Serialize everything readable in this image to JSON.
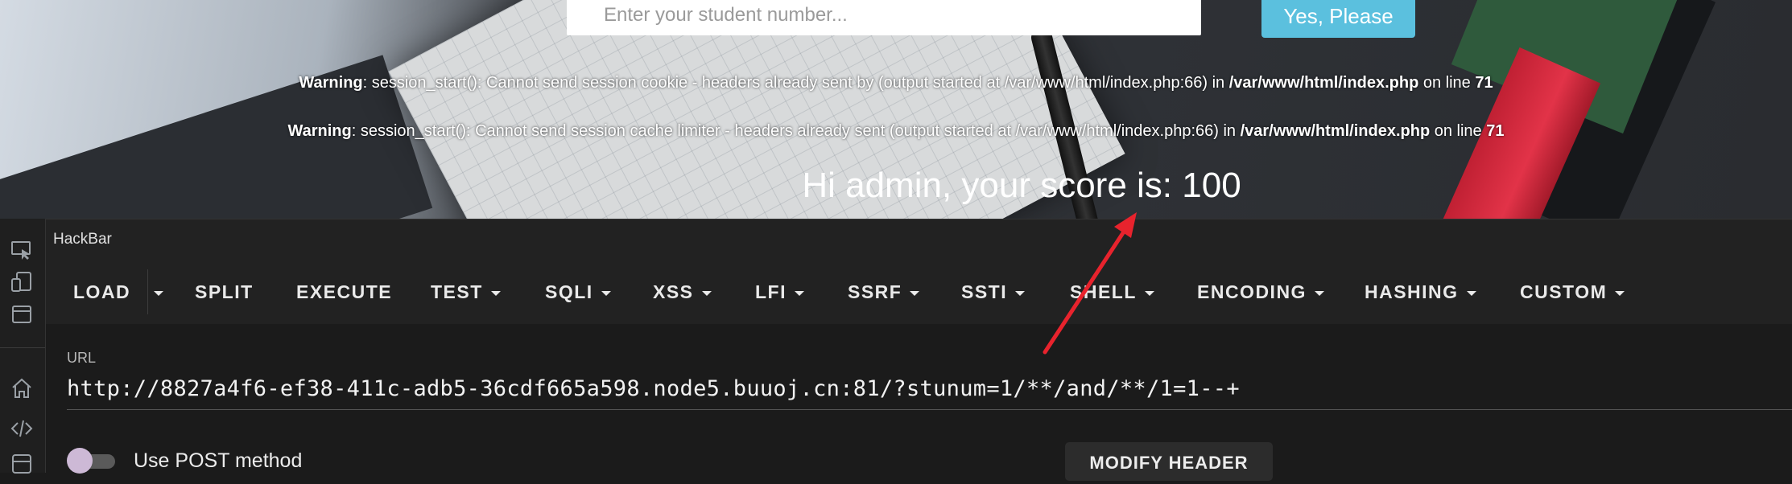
{
  "webpage": {
    "input_placeholder": "Enter your student number...",
    "submit_label": "Yes, Please",
    "warnings": [
      {
        "prefix": "Warning",
        "text": ": session_start(): Cannot send session cookie - headers already sent by (output started at /var/www/html/index.php:66) in ",
        "path": "/var/www/html/index.php",
        "line_text": " on line ",
        "line": "71"
      },
      {
        "prefix": "Warning",
        "text": ": session_start(): Cannot send session cache limiter - headers already sent (output started at /var/www/html/index.php:66) in ",
        "path": "/var/www/html/index.php",
        "line_text": " on line ",
        "line": "71"
      }
    ],
    "score_text": "Hi admin, your score is: 100"
  },
  "devtools": {
    "rail_icons": [
      "inspect-icon",
      "device-icon",
      "window-icon",
      "home-icon",
      "code-icon",
      "storage-icon"
    ]
  },
  "hackbar": {
    "tab_title": "HackBar",
    "toolbar": {
      "load": "LOAD",
      "split": "SPLIT",
      "execute": "EXECUTE",
      "test": "TEST",
      "sqli": "SQLI",
      "xss": "XSS",
      "lfi": "LFI",
      "ssrf": "SSRF",
      "ssti": "SSTI",
      "shell": "SHELL",
      "encoding": "ENCODING",
      "hashing": "HASHING",
      "custom": "CUSTOM"
    },
    "url_label": "URL",
    "url_value": "http://8827a4f6-ef38-411c-adb5-36cdf665a598.node5.buuoj.cn:81/?stunum=1/**/and/**/1=1--+",
    "post_label": "Use POST method",
    "post_enabled": false,
    "modify_header": "MODIFY HEADER"
  },
  "colors": {
    "submit_button": "#5bc0de",
    "arrow": "#e8232d",
    "toggle_knob": "#cdb9d6"
  }
}
